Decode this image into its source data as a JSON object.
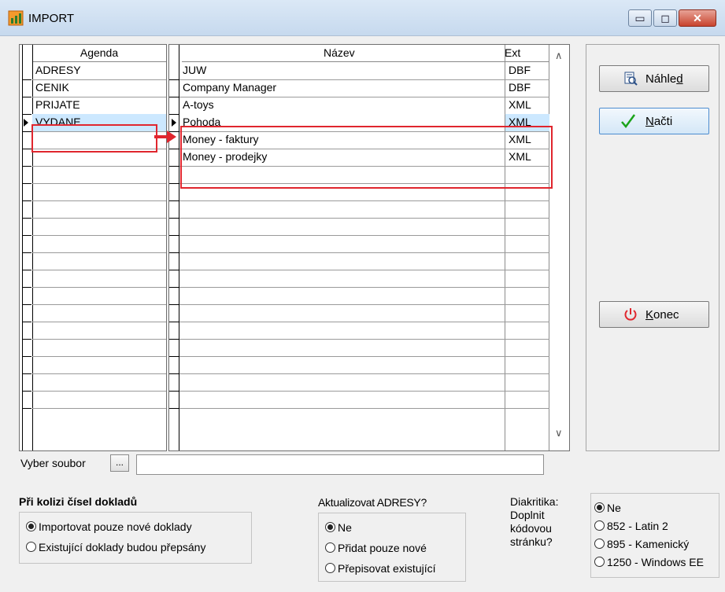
{
  "window": {
    "title": "IMPORT",
    "min_glyph": "▭",
    "max_glyph": "◻",
    "close_glyph": "✕"
  },
  "agenda_grid": {
    "header": "Agenda",
    "rows": [
      "ADRESY",
      "CENIK",
      "PRIJATE",
      "VYDANE"
    ],
    "selected_index": 3,
    "empty_rows": 16
  },
  "files_grid": {
    "headers": {
      "name": "Název",
      "ext": "Ext"
    },
    "rows": [
      {
        "name": "JUW",
        "ext": "DBF"
      },
      {
        "name": "Company Manager",
        "ext": "DBF"
      },
      {
        "name": "A-toys",
        "ext": "XML"
      },
      {
        "name": "Pohoda",
        "ext": "XML"
      },
      {
        "name": "Money - faktury",
        "ext": "XML"
      },
      {
        "name": "Money - prodejky",
        "ext": "XML"
      }
    ],
    "selected_index": 3,
    "empty_rows": 14,
    "scroll_up_glyph": "∧",
    "scroll_down_glyph": "∨"
  },
  "buttons": {
    "preview": {
      "label_pre": "Náhle",
      "label_ul": "d",
      "label_post": "",
      "icon": "preview-icon"
    },
    "load": {
      "label_pre": "",
      "label_ul": "N",
      "label_post": "ačti",
      "icon": "checkmark-icon"
    },
    "close": {
      "label_pre": "",
      "label_ul": "K",
      "label_post": "onec",
      "icon": "power-icon"
    }
  },
  "file_select": {
    "label": "Vyber soubor",
    "browse": "...",
    "value": ""
  },
  "conflict": {
    "title": "Při kolizi čísel dokladů",
    "options": [
      "Importovat pouze nové doklady",
      "Existující doklady budou přepsány"
    ],
    "selected": 0
  },
  "update_addresses": {
    "title": "Aktualizovat ADRESY?",
    "options": [
      "Ne",
      "Přidat pouze nové",
      "Přepisovat existující"
    ],
    "selected": 0
  },
  "diacritics": {
    "label_lines": [
      "Diakritika:",
      "Doplnit",
      "kódovou",
      "stránku?"
    ],
    "options": [
      "Ne",
      "852 - Latin 2",
      "895 - Kamenický",
      "1250 - Windows EE"
    ],
    "selected": 0
  },
  "colors": {
    "selection": "#cce8ff",
    "highlight": "#e0262e",
    "check": "#1aa31a",
    "power": "#e0262e"
  }
}
